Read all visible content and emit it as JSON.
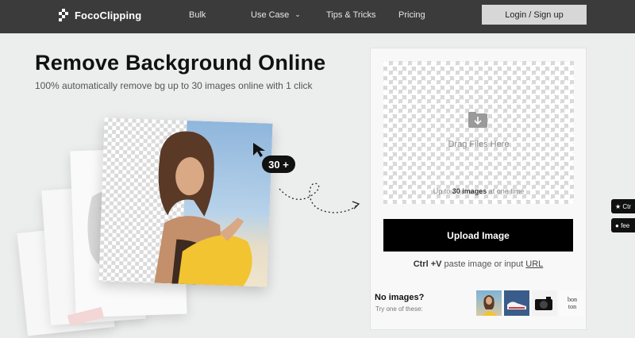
{
  "header": {
    "logo_text": "FocoClipping",
    "nav": [
      {
        "label": "Bulk"
      },
      {
        "label": "Use Case"
      },
      {
        "label": "Tips & Tricks"
      },
      {
        "label": "Pricing"
      }
    ],
    "login_label": "Login / Sign up"
  },
  "hero": {
    "title": "Remove Background Online",
    "subtitle": "100% automatically remove bg up to 30 images online with 1 click",
    "badge": "30 +"
  },
  "upload": {
    "drag_text": "Drag Files Here",
    "limit_prefix": "Up to ",
    "limit_bold": "30 images",
    "limit_suffix": " at one time",
    "button_label": "Upload Image",
    "paste_shortcut": "Ctrl +V",
    "paste_text": " paste image or input ",
    "paste_link": "URL"
  },
  "samples": {
    "title": "No images?",
    "subtitle": "Try one of these:",
    "items": [
      {
        "icon": "woman-portrait-sample"
      },
      {
        "icon": "sneakers-sample"
      },
      {
        "icon": "camera-sample"
      },
      {
        "icon": "logo-text-sample",
        "text": "bon ton"
      }
    ]
  },
  "side_buttons": [
    {
      "icon": "star-icon",
      "label": "Ctr"
    },
    {
      "icon": "chat-icon",
      "label": "fee"
    }
  ],
  "colors": {
    "header_bg": "#3b3b3b",
    "page_bg": "#eceded",
    "primary_button": "#000000",
    "login_button": "#d7d7d7"
  }
}
